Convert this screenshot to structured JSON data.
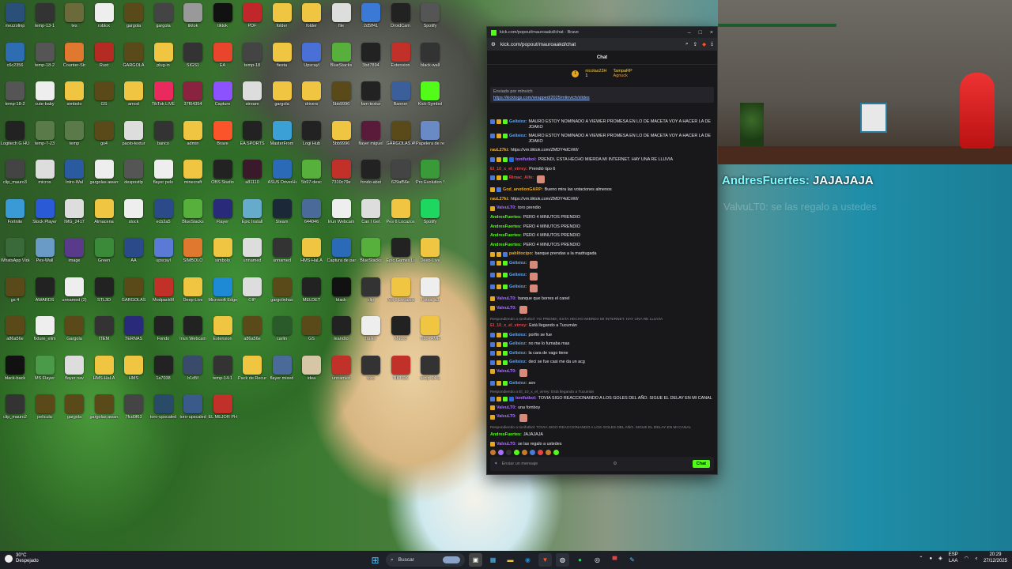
{
  "desktop_icons": [
    {
      "l": "mezzolinp",
      "c": "#2a4f78"
    },
    {
      "l": "temp-13-1",
      "c": "#333"
    },
    {
      "l": "tes",
      "c": "#6a6a3a"
    },
    {
      "l": "roblox",
      "c": "#eee"
    },
    {
      "l": "gargola",
      "c": "#5a4a1a"
    },
    {
      "l": "gargola",
      "c": "#444"
    },
    {
      "l": "tiktok",
      "c": "#999"
    },
    {
      "l": "tiktok",
      "c": "#111"
    },
    {
      "l": "PDF",
      "c": "#c0262a"
    },
    {
      "l": "folder",
      "c": "#f0c541"
    },
    {
      "l": "folder",
      "c": "#f0c541"
    },
    {
      "l": "file",
      "c": "#ddd"
    },
    {
      "l": "2d5ff41",
      "c": "#3a7ad6"
    },
    {
      "l": "DroidCam",
      "c": "#222"
    },
    {
      "l": "Spotify",
      "c": "#555"
    },
    {
      "l": "c6c2356",
      "c": "#2f6db3"
    },
    {
      "l": "temp-18-2",
      "c": "#555"
    },
    {
      "l": "Counter-Str",
      "c": "#e07830"
    },
    {
      "l": "Rust",
      "c": "#b52b24"
    },
    {
      "l": "GARGOLA",
      "c": "#5a4a1a"
    },
    {
      "l": "plug-in",
      "c": "#f0c541"
    },
    {
      "l": "SIGS1",
      "c": "#333"
    },
    {
      "l": "EA",
      "c": "#e8452c"
    },
    {
      "l": "temp-18",
      "c": "#444"
    },
    {
      "l": "fiesta",
      "c": "#f0c541"
    },
    {
      "l": "Upscayl",
      "c": "#4a6fd6"
    },
    {
      "l": "BlueStacks",
      "c": "#57b03c"
    },
    {
      "l": "3bd7894",
      "c": "#222"
    },
    {
      "l": "Extension",
      "c": "#c2302a"
    },
    {
      "l": "black-wall",
      "c": "#333"
    },
    {
      "l": "temp-18-2",
      "c": "#555"
    },
    {
      "l": "cute-baby",
      "c": "#eee"
    },
    {
      "l": "simbolo",
      "c": "#f0c541"
    },
    {
      "l": "GS",
      "c": "#5a4a1a"
    },
    {
      "l": "amod",
      "c": "#f0c541"
    },
    {
      "l": "TikTok LIVE",
      "c": "#ea2a5e"
    },
    {
      "l": "37f04354",
      "c": "#8a2340"
    },
    {
      "l": "Capture",
      "c": "#8c52ff"
    },
    {
      "l": "stream",
      "c": "#ddd"
    },
    {
      "l": "gargola",
      "c": "#f0c541"
    },
    {
      "l": "drivers",
      "c": "#f0c541"
    },
    {
      "l": "5bb9996",
      "c": "#5a4a1a"
    },
    {
      "l": "fam-textur",
      "c": "#222"
    },
    {
      "l": "Banner",
      "c": "#3a5f9a"
    },
    {
      "l": "Kick-Symbol",
      "c": "#53fc18"
    },
    {
      "l": "Logitech G HUB",
      "c": "#222"
    },
    {
      "l": "temp-7-23",
      "c": "#5a7a4a"
    },
    {
      "l": "temp",
      "c": "#5a7a4a"
    },
    {
      "l": "gs4",
      "c": "#5a4a1a"
    },
    {
      "l": "paolo-textur",
      "c": "#ddd"
    },
    {
      "l": "banco",
      "c": "#333"
    },
    {
      "l": "admin",
      "c": "#f0c541"
    },
    {
      "l": "Brave",
      "c": "#fb542b"
    },
    {
      "l": "EA SPORTS",
      "c": "#222"
    },
    {
      "l": "MasterFrom",
      "c": "#3aa0d6"
    },
    {
      "l": "Logi Hub",
      "c": "#222"
    },
    {
      "l": "5bb9996",
      "c": "#f0c541"
    },
    {
      "l": "flayer miguel",
      "c": "#5a1a3a"
    },
    {
      "l": "GARGOLAS AWARDS",
      "c": "#5a4a1a"
    },
    {
      "l": "Papelera de reciclaje",
      "c": "#6a8ac6"
    },
    {
      "l": "clip_mauro3",
      "c": "#444"
    },
    {
      "l": "micros",
      "c": "#ddd"
    },
    {
      "l": "Intro-Wal",
      "c": "#2a5aa0"
    },
    {
      "l": "gargolas awards",
      "c": "#eee"
    },
    {
      "l": "despostlp",
      "c": "#555"
    },
    {
      "l": "flayer pelo",
      "c": "#eee"
    },
    {
      "l": "minecraft",
      "c": "#f0c541"
    },
    {
      "l": "OBS Studio",
      "c": "#222"
    },
    {
      "l": "a81110",
      "c": "#3a1a2a"
    },
    {
      "l": "ASUS DriverHub",
      "c": "#2a6ab6"
    },
    {
      "l": "5b97-desc",
      "c": "#57b03c"
    },
    {
      "l": "7310c79e",
      "c": "#c2302a"
    },
    {
      "l": "fondo-abst",
      "c": "#222"
    },
    {
      "l": "629af56e",
      "c": "#444"
    },
    {
      "l": "Pro Evolution Soccer",
      "c": "#3a9a3a"
    },
    {
      "l": "Fortnite",
      "c": "#3a9ad6"
    },
    {
      "l": "Stock Player",
      "c": "#2a5ad6"
    },
    {
      "l": "IMG_2417",
      "c": "#ddd"
    },
    {
      "l": "Almacena",
      "c": "#f0c541"
    },
    {
      "l": "stock",
      "c": "#eee"
    },
    {
      "l": "ecb2a5",
      "c": "#2a4a8a"
    },
    {
      "l": "BlueStacks",
      "c": "#57b03c"
    },
    {
      "l": "Flayer",
      "c": "#2a2a7a"
    },
    {
      "l": "Epic Install",
      "c": "#6ac"
    },
    {
      "l": "Steam",
      "c": "#1b2838"
    },
    {
      "l": "644046",
      "c": "#4a6a9a"
    },
    {
      "l": "Iriun Webcam",
      "c": "#eee"
    },
    {
      "l": "Can I Get",
      "c": "#ddd"
    },
    {
      "l": "Pes 6 Locazos",
      "c": "#f0c541"
    },
    {
      "l": "Spotify",
      "c": "#1ed760"
    },
    {
      "l": "WhatsApp Video",
      "c": "#3a6a3a"
    },
    {
      "l": "Pes-Wall",
      "c": "#6a9ac6"
    },
    {
      "l": "image",
      "c": "#5a3a8a"
    },
    {
      "l": "Green",
      "c": "#3a8a3a"
    },
    {
      "l": "AA",
      "c": "#2a4a8a"
    },
    {
      "l": "upscayl",
      "c": "#5a7ad6"
    },
    {
      "l": "SIMBOLO",
      "c": "#e07830"
    },
    {
      "l": "simbolo",
      "c": "#f0c541"
    },
    {
      "l": "unnamed",
      "c": "#ddd"
    },
    {
      "l": "unnamed",
      "c": "#333"
    },
    {
      "l": "HMS-HaLA",
      "c": "#f0c541"
    },
    {
      "l": "Captura de pantalla",
      "c": "#2a6ab6"
    },
    {
      "l": "BlueStacks",
      "c": "#57b03c"
    },
    {
      "l": "Epic Games Launcher",
      "c": "#222"
    },
    {
      "l": "Deep-Live",
      "c": "#f0c541"
    },
    {
      "l": "gs 4",
      "c": "#5a4a1a"
    },
    {
      "l": "AWARDS",
      "c": "#222"
    },
    {
      "l": "unnamed (2)",
      "c": "#eee"
    },
    {
      "l": "STL3D",
      "c": "#222"
    },
    {
      "l": "GARGOLAS",
      "c": "#5a4a1a"
    },
    {
      "l": "ModpackM",
      "c": "#c2302a"
    },
    {
      "l": "Deep-Live",
      "c": "#f0c541"
    },
    {
      "l": "Microsoft Edge",
      "c": "#1e8ad6"
    },
    {
      "l": "OIP",
      "c": "#ddd"
    },
    {
      "l": "gargolinhas",
      "c": "#5a4a1a"
    },
    {
      "l": "MELDET",
      "c": "#222"
    },
    {
      "l": "black",
      "c": "#111"
    },
    {
      "l": "clip",
      "c": "#333"
    },
    {
      "l": "Pes 6 Locazos",
      "c": "#f0c541"
    },
    {
      "l": "Futsal a3",
      "c": "#eee"
    },
    {
      "l": "a86a56e",
      "c": "#5a4a1a"
    },
    {
      "l": "fixture_elim",
      "c": "#eee"
    },
    {
      "l": "Gargola",
      "c": "#5a4a1a"
    },
    {
      "l": "ITEM",
      "c": "#333"
    },
    {
      "l": "TERNAS",
      "c": "#2a2a7a"
    },
    {
      "l": "Fondo",
      "c": "#222"
    },
    {
      "l": "Iriun Webcam",
      "c": "#222"
    },
    {
      "l": "Extension",
      "c": "#f0c541"
    },
    {
      "l": "a86a56e",
      "c": "#5a4a1a"
    },
    {
      "l": "carlin",
      "c": "#2a5a2a"
    },
    {
      "l": "GS",
      "c": "#5a4a1a"
    },
    {
      "l": "leandro",
      "c": "#222"
    },
    {
      "l": "trailer",
      "c": "#eee"
    },
    {
      "l": "Mauro",
      "c": "#222"
    },
    {
      "l": "Tibor AMR",
      "c": "#f0c541"
    },
    {
      "l": "black-back",
      "c": "#111"
    },
    {
      "l": "MS Flayer",
      "c": "#4a9a4a"
    },
    {
      "l": "flayer nav",
      "c": "#ddd"
    },
    {
      "l": "HMS-HaLA",
      "c": "#f0c541"
    },
    {
      "l": "HMS",
      "c": "#f0c541"
    },
    {
      "l": "1a7038",
      "c": "#222"
    },
    {
      "l": "b1d5f",
      "c": "#3a4a6a"
    },
    {
      "l": "temp-14-1",
      "c": "#333"
    },
    {
      "l": "Pack de Recursos",
      "c": "#f0c541"
    },
    {
      "l": "flayer mixed",
      "c": "#4a6a9a"
    },
    {
      "l": "idea",
      "c": "#d6c6a6"
    },
    {
      "l": "unnamed",
      "c": "#c2302a"
    },
    {
      "l": "toro",
      "c": "#333"
    },
    {
      "l": "TIKTOK",
      "c": "#c2302a"
    },
    {
      "l": "temp-14-1",
      "c": "#333"
    },
    {
      "l": "clip_mauro2",
      "c": "#333"
    },
    {
      "l": "pelicula",
      "c": "#5a4a1a"
    },
    {
      "l": "gargola",
      "c": "#5a4a1a"
    },
    {
      "l": "gargolas awards",
      "c": "#5a4a1a"
    },
    {
      "l": "7fcd0f63",
      "c": "#444"
    },
    {
      "l": "toro-upscaled",
      "c": "#2a4a6a"
    },
    {
      "l": "toro-upscaled",
      "c": "#3a5a8a"
    },
    {
      "l": "EL MEJOR PHONK",
      "c": "#c2302a"
    }
  ],
  "browser": {
    "title": "kick.com/popout/mauroaakd/chat - Brave",
    "url": "kick.com/popout/mauroaakd/chat",
    "chat_title": "Chat",
    "top_donors": [
      {
        "name": "nicolas23H",
        "amt": "1"
      },
      {
        "name": "TampaRP",
        "amt": "1"
      },
      {
        "name": "Agnuck",
        "amt": "1"
      }
    ],
    "pinned": {
      "by": "Enviado por mlnvich",
      "link": "https://kicktogs.com/wrapped/2025/mlinvich/slides"
    },
    "messages": [
      {
        "u": "Gelisioz:",
        "uc": "#58a6ff",
        "t": "MAURO ESTOY NOMINADO A VIEWER PROMESA EN LO DE MACETA VOY A HACER LA DE JOAKO",
        "b": [
          "#4a7ad6",
          "#e5a823",
          "#53fc18"
        ]
      },
      {
        "u": "Gelisioz:",
        "uc": "#58a6ff",
        "t": "MAURO ESTOY NOMINADO A VIEWER PROMESA EN LO DE MACETA VOY A HACER LA DE JOAKO",
        "b": [
          "#4a7ad6",
          "#e5a823",
          "#53fc18"
        ]
      },
      {
        "u": "rauL27ki:",
        "uc": "#f0b232",
        "t": "https://vm.tiktok.com/ZMDY4dCrWI/",
        "b": []
      },
      {
        "u": "tonifutbol:",
        "uc": "#a970ff",
        "t": "PRENDI, ESTA HECHO MIERDA MI INTERNET. HAY UNA RE LLUVIA",
        "b": [
          "#4a7ad6",
          "#e5a823",
          "#53fc18",
          "#2a6ad6"
        ]
      },
      {
        "u": "El_10_x_el_virrey:",
        "uc": "#e24545",
        "t": "Prendió tipo 6",
        "b": []
      },
      {
        "u": "Rimac_Alfe:",
        "uc": "#e24545",
        "t": "",
        "b": [
          "#4a7ad6",
          "#e5a823",
          "#53fc18"
        ]
      },
      {
        "u": "God_anotionGARP:",
        "uc": "#e5a823",
        "t": "Bueno mira las votaciones almenos",
        "b": [
          "#e5a823",
          "#4a7ad6"
        ]
      },
      {
        "u": "rauL27ki:",
        "uc": "#f0b232",
        "t": "https://vm.tiktok.com/ZMDY4dCrWI/",
        "b": []
      },
      {
        "u": "ValvuLT0:",
        "uc": "#a970ff",
        "t": "toro prendio",
        "b": [
          "#e5a823"
        ]
      },
      {
        "u": "AndresFuertes:",
        "uc": "#53fc18",
        "t": "PERO 4 MINUTOS PRENDIO",
        "b": []
      },
      {
        "u": "AndresFuertes:",
        "uc": "#53fc18",
        "t": "PERO 4 MINUTOS PRENDIO",
        "b": []
      },
      {
        "u": "AndresFuertes:",
        "uc": "#53fc18",
        "t": "PERO 4 MINUTOS PRENDIO",
        "b": []
      },
      {
        "u": "AndresFuertes:",
        "uc": "#53fc18",
        "t": "PERO 4 MINUTOS PRENDIO",
        "b": []
      },
      {
        "u": "pablitocipo:",
        "uc": "#e5a823",
        "t": "banque prendas a la madrugada",
        "b": [
          "#e5a823",
          "#e5a823",
          "#4a7ad6"
        ]
      },
      {
        "u": "Gelisioz:",
        "uc": "#58a6ff",
        "t": "",
        "b": [
          "#4a7ad6",
          "#e5a823",
          "#53fc18"
        ]
      },
      {
        "u": "Gelisioz:",
        "uc": "#58a6ff",
        "t": "",
        "b": [
          "#4a7ad6",
          "#e5a823",
          "#53fc18"
        ]
      },
      {
        "u": "Gelisioz:",
        "uc": "#58a6ff",
        "t": "",
        "b": [
          "#4a7ad6",
          "#e5a823",
          "#53fc18"
        ]
      },
      {
        "u": "ValvuLT0:",
        "uc": "#a970ff",
        "t": "banque que borres el canel",
        "b": [
          "#e5a823"
        ]
      },
      {
        "u": "ValvuLT0:",
        "uc": "#a970ff",
        "t": "",
        "b": [
          "#e5a823"
        ]
      },
      {
        "reply": "Respondiendo a tonifutbol: YO PRENDI, ESTA HECHO MIERDA MI INTERNET. HAY UNA RE LLUVIA"
      },
      {
        "u": "El_10_x_el_virrey:",
        "uc": "#e24545",
        "t": "Está llegando a Tucumán",
        "b": []
      },
      {
        "u": "Gelisioz:",
        "uc": "#58a6ff",
        "t": "porfin se fue",
        "b": [
          "#4a7ad6",
          "#e5a823",
          "#53fc18"
        ]
      },
      {
        "u": "Gelisioz:",
        "uc": "#58a6ff",
        "t": "no me lo fumaba mas",
        "b": [
          "#4a7ad6",
          "#e5a823",
          "#53fc18"
        ]
      },
      {
        "u": "Gelisioz:",
        "uc": "#58a6ff",
        "t": "la cara de vago tiene",
        "b": [
          "#4a7ad6",
          "#e5a823",
          "#53fc18"
        ]
      },
      {
        "u": "Gelisioz:",
        "uc": "#58a6ff",
        "t": "deci se fue casi me da un acg",
        "b": [
          "#4a7ad6",
          "#e5a823",
          "#53fc18"
        ]
      },
      {
        "u": "ValvuLT0:",
        "uc": "#a970ff",
        "t": "",
        "b": [
          "#e5a823"
        ]
      },
      {
        "u": "Gelisioz:",
        "uc": "#58a6ff",
        "t": "aov",
        "b": [
          "#4a7ad6",
          "#e5a823",
          "#53fc18"
        ]
      },
      {
        "reply": "Respondiendo a El_10_x_el_virrey: Está llegando a Tucumán"
      },
      {
        "u": "tonifutbol:",
        "uc": "#a970ff",
        "t": "TOVIA SIGO REACCIONANDO A LOS GOLES DEL AÑO. SIGUE EL DELAY EN MI CANAL",
        "b": [
          "#4a7ad6",
          "#e5a823",
          "#53fc18",
          "#2a6ad6"
        ]
      },
      {
        "u": "ValvuLT0:",
        "uc": "#a970ff",
        "t": "una fomboy",
        "b": [
          "#e5a823"
        ]
      },
      {
        "u": "ValvuLT0:",
        "uc": "#a970ff",
        "t": "",
        "b": [
          "#e5a823"
        ]
      },
      {
        "reply": "Respondiendo a tonifutbol: TOVIA SIGO REACCIONANDO A LOS GOLES DEL AÑO. SIGUE EL DELAY EN MI CANAL"
      },
      {
        "u": "AndresFuertes:",
        "uc": "#53fc18",
        "t": "JAJAJAJA",
        "b": []
      },
      {
        "u": "ValvuLT0:",
        "uc": "#a970ff",
        "t": "se las regalo a ustedes",
        "b": [
          "#e5a823"
        ]
      }
    ],
    "input_placeholder": "Enviar un mensaje",
    "send_label": "Chat"
  },
  "overlay": {
    "name": "AndresFuertes:",
    "text": "JAJAJAJA",
    "faded": "ValvuLT0: se las regalo a ustedes"
  },
  "taskbar": {
    "temp": "30°C",
    "condition": "Despejado",
    "search": "Buscar",
    "lang1": "ESP",
    "lang2": "LAA",
    "time": "20:29",
    "date": "27/12/2025"
  }
}
